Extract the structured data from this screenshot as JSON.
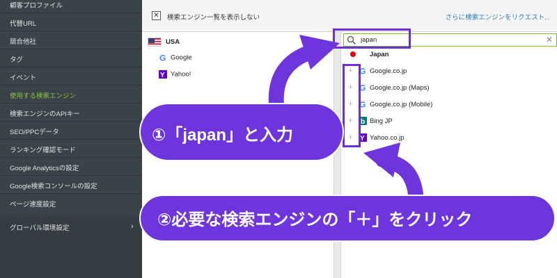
{
  "sidebar": {
    "items": [
      {
        "label": "顧客プロファイル"
      },
      {
        "label": "代替URL"
      },
      {
        "label": "競合他社"
      },
      {
        "label": "タグ"
      },
      {
        "label": "イベント"
      },
      {
        "label": "使用する検索エンジン"
      },
      {
        "label": "検索エンジンのAPIキー"
      },
      {
        "label": "SEO/PPCデータ"
      },
      {
        "label": "ランキング確認モード"
      },
      {
        "label": "Google Analyticsの設定"
      },
      {
        "label": "Google検索コンソールの設定"
      },
      {
        "label": "ページ速度設定"
      }
    ],
    "global": {
      "label": "グローバル環境設定",
      "chevron": "›"
    }
  },
  "topbar": {
    "checkbox_mark": "✕",
    "hide_label": "検索エンジン一覧を表示しない",
    "request_link": "さらに検索エンジンをリクエスト..."
  },
  "left_pane": {
    "country": "USA",
    "engines": [
      {
        "icon": "google-icon",
        "label": "Google"
      },
      {
        "icon": "yahoo-icon",
        "label": "Yahoo!"
      }
    ]
  },
  "search": {
    "value": "japan",
    "clear": "✕"
  },
  "results": {
    "country": "Japan",
    "engines": [
      {
        "icon": "google-icon",
        "label": "Google.co.jp"
      },
      {
        "icon": "google-icon",
        "label": "Google.co.jp (Maps)"
      },
      {
        "icon": "google-icon",
        "label": "Google.co.jp (Mobile)"
      },
      {
        "icon": "bing-icon",
        "label": "Bing JP"
      },
      {
        "icon": "yahoo-icon",
        "label": "Yahoo.co.jp"
      }
    ],
    "plus": "+"
  },
  "callouts": {
    "step1": "①「japan」と入力",
    "step2": "②必要な検索エンジンの「＋」をクリック"
  },
  "colors": {
    "accent": "#6e35dc",
    "active_menu": "#8dc63f",
    "link": "#2a7ab8"
  }
}
